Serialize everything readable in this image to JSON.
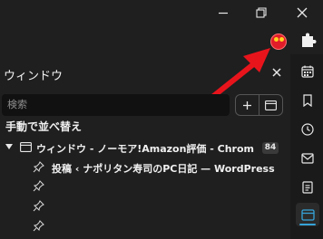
{
  "panel": {
    "title": "ウィンドウ",
    "search_placeholder": "検索",
    "section_title": "手動で並べ替え",
    "window_row": {
      "label": "ウィンドウ - ノーモア!Amazon評価 - Chrome ウ…",
      "tab_count": "84"
    },
    "tabs": [
      {
        "label": "投稿 ‹ ナポリタン寿司のPC日記 — WordPress"
      },
      {
        "label": ""
      },
      {
        "label": ""
      },
      {
        "label": ""
      }
    ]
  },
  "colors": {
    "background": "#1f1f1f",
    "accent": "#36a3d9",
    "annotation_arrow": "#e8141c"
  },
  "icons": {
    "titlebar": [
      "minimize-icon",
      "restore-icon",
      "close-icon"
    ],
    "extensions": "puzzle-icon",
    "sidebar": [
      "calendar-icon",
      "bookmark-icon",
      "history-icon",
      "mail-icon",
      "reading-list-icon",
      "tab-window-icon"
    ]
  }
}
